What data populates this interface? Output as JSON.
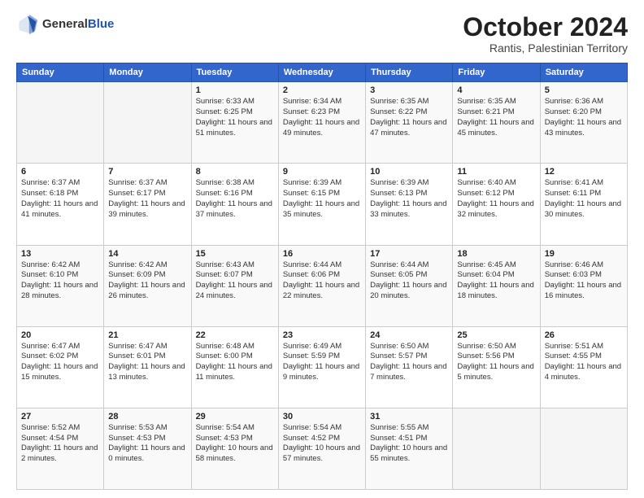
{
  "header": {
    "logo_line1": "General",
    "logo_line2": "Blue",
    "month": "October 2024",
    "location": "Rantis, Palestinian Territory"
  },
  "weekdays": [
    "Sunday",
    "Monday",
    "Tuesday",
    "Wednesday",
    "Thursday",
    "Friday",
    "Saturday"
  ],
  "weeks": [
    [
      {
        "day": "",
        "sunrise": "",
        "sunset": "",
        "daylight": ""
      },
      {
        "day": "",
        "sunrise": "",
        "sunset": "",
        "daylight": ""
      },
      {
        "day": "1",
        "sunrise": "Sunrise: 6:33 AM",
        "sunset": "Sunset: 6:25 PM",
        "daylight": "Daylight: 11 hours and 51 minutes."
      },
      {
        "day": "2",
        "sunrise": "Sunrise: 6:34 AM",
        "sunset": "Sunset: 6:23 PM",
        "daylight": "Daylight: 11 hours and 49 minutes."
      },
      {
        "day": "3",
        "sunrise": "Sunrise: 6:35 AM",
        "sunset": "Sunset: 6:22 PM",
        "daylight": "Daylight: 11 hours and 47 minutes."
      },
      {
        "day": "4",
        "sunrise": "Sunrise: 6:35 AM",
        "sunset": "Sunset: 6:21 PM",
        "daylight": "Daylight: 11 hours and 45 minutes."
      },
      {
        "day": "5",
        "sunrise": "Sunrise: 6:36 AM",
        "sunset": "Sunset: 6:20 PM",
        "daylight": "Daylight: 11 hours and 43 minutes."
      }
    ],
    [
      {
        "day": "6",
        "sunrise": "Sunrise: 6:37 AM",
        "sunset": "Sunset: 6:18 PM",
        "daylight": "Daylight: 11 hours and 41 minutes."
      },
      {
        "day": "7",
        "sunrise": "Sunrise: 6:37 AM",
        "sunset": "Sunset: 6:17 PM",
        "daylight": "Daylight: 11 hours and 39 minutes."
      },
      {
        "day": "8",
        "sunrise": "Sunrise: 6:38 AM",
        "sunset": "Sunset: 6:16 PM",
        "daylight": "Daylight: 11 hours and 37 minutes."
      },
      {
        "day": "9",
        "sunrise": "Sunrise: 6:39 AM",
        "sunset": "Sunset: 6:15 PM",
        "daylight": "Daylight: 11 hours and 35 minutes."
      },
      {
        "day": "10",
        "sunrise": "Sunrise: 6:39 AM",
        "sunset": "Sunset: 6:13 PM",
        "daylight": "Daylight: 11 hours and 33 minutes."
      },
      {
        "day": "11",
        "sunrise": "Sunrise: 6:40 AM",
        "sunset": "Sunset: 6:12 PM",
        "daylight": "Daylight: 11 hours and 32 minutes."
      },
      {
        "day": "12",
        "sunrise": "Sunrise: 6:41 AM",
        "sunset": "Sunset: 6:11 PM",
        "daylight": "Daylight: 11 hours and 30 minutes."
      }
    ],
    [
      {
        "day": "13",
        "sunrise": "Sunrise: 6:42 AM",
        "sunset": "Sunset: 6:10 PM",
        "daylight": "Daylight: 11 hours and 28 minutes."
      },
      {
        "day": "14",
        "sunrise": "Sunrise: 6:42 AM",
        "sunset": "Sunset: 6:09 PM",
        "daylight": "Daylight: 11 hours and 26 minutes."
      },
      {
        "day": "15",
        "sunrise": "Sunrise: 6:43 AM",
        "sunset": "Sunset: 6:07 PM",
        "daylight": "Daylight: 11 hours and 24 minutes."
      },
      {
        "day": "16",
        "sunrise": "Sunrise: 6:44 AM",
        "sunset": "Sunset: 6:06 PM",
        "daylight": "Daylight: 11 hours and 22 minutes."
      },
      {
        "day": "17",
        "sunrise": "Sunrise: 6:44 AM",
        "sunset": "Sunset: 6:05 PM",
        "daylight": "Daylight: 11 hours and 20 minutes."
      },
      {
        "day": "18",
        "sunrise": "Sunrise: 6:45 AM",
        "sunset": "Sunset: 6:04 PM",
        "daylight": "Daylight: 11 hours and 18 minutes."
      },
      {
        "day": "19",
        "sunrise": "Sunrise: 6:46 AM",
        "sunset": "Sunset: 6:03 PM",
        "daylight": "Daylight: 11 hours and 16 minutes."
      }
    ],
    [
      {
        "day": "20",
        "sunrise": "Sunrise: 6:47 AM",
        "sunset": "Sunset: 6:02 PM",
        "daylight": "Daylight: 11 hours and 15 minutes."
      },
      {
        "day": "21",
        "sunrise": "Sunrise: 6:47 AM",
        "sunset": "Sunset: 6:01 PM",
        "daylight": "Daylight: 11 hours and 13 minutes."
      },
      {
        "day": "22",
        "sunrise": "Sunrise: 6:48 AM",
        "sunset": "Sunset: 6:00 PM",
        "daylight": "Daylight: 11 hours and 11 minutes."
      },
      {
        "day": "23",
        "sunrise": "Sunrise: 6:49 AM",
        "sunset": "Sunset: 5:59 PM",
        "daylight": "Daylight: 11 hours and 9 minutes."
      },
      {
        "day": "24",
        "sunrise": "Sunrise: 6:50 AM",
        "sunset": "Sunset: 5:57 PM",
        "daylight": "Daylight: 11 hours and 7 minutes."
      },
      {
        "day": "25",
        "sunrise": "Sunrise: 6:50 AM",
        "sunset": "Sunset: 5:56 PM",
        "daylight": "Daylight: 11 hours and 5 minutes."
      },
      {
        "day": "26",
        "sunrise": "Sunrise: 5:51 AM",
        "sunset": "Sunset: 4:55 PM",
        "daylight": "Daylight: 11 hours and 4 minutes."
      }
    ],
    [
      {
        "day": "27",
        "sunrise": "Sunrise: 5:52 AM",
        "sunset": "Sunset: 4:54 PM",
        "daylight": "Daylight: 11 hours and 2 minutes."
      },
      {
        "day": "28",
        "sunrise": "Sunrise: 5:53 AM",
        "sunset": "Sunset: 4:53 PM",
        "daylight": "Daylight: 11 hours and 0 minutes."
      },
      {
        "day": "29",
        "sunrise": "Sunrise: 5:54 AM",
        "sunset": "Sunset: 4:53 PM",
        "daylight": "Daylight: 10 hours and 58 minutes."
      },
      {
        "day": "30",
        "sunrise": "Sunrise: 5:54 AM",
        "sunset": "Sunset: 4:52 PM",
        "daylight": "Daylight: 10 hours and 57 minutes."
      },
      {
        "day": "31",
        "sunrise": "Sunrise: 5:55 AM",
        "sunset": "Sunset: 4:51 PM",
        "daylight": "Daylight: 10 hours and 55 minutes."
      },
      {
        "day": "",
        "sunrise": "",
        "sunset": "",
        "daylight": ""
      },
      {
        "day": "",
        "sunrise": "",
        "sunset": "",
        "daylight": ""
      }
    ]
  ]
}
